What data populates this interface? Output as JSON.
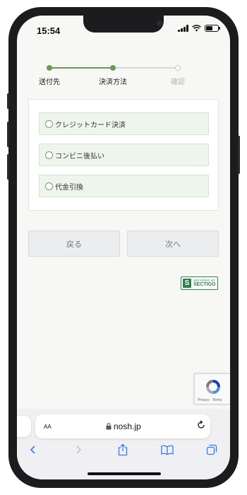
{
  "status_bar": {
    "time": "15:54"
  },
  "stepper": {
    "steps": [
      {
        "label": "送付先",
        "state": "done"
      },
      {
        "label": "決済方法",
        "state": "current"
      },
      {
        "label": "確認",
        "state": "pending"
      }
    ],
    "colors": {
      "active": "#6a9a52",
      "inactive": "#d6d6d6",
      "pending_label": "#b5b5b5"
    }
  },
  "payment_options": [
    {
      "label": "クレジットカード決済",
      "selected": false
    },
    {
      "label": "コンビニ後払い",
      "selected": false
    },
    {
      "label": "代金引換",
      "selected": false
    }
  ],
  "buttons": {
    "back": "戻る",
    "next": "次へ"
  },
  "security_seal": {
    "top_text": "SECURED BY",
    "brand": "SECTIGO",
    "mark": "S"
  },
  "recaptcha": {
    "links": "Privacy - Terms"
  },
  "browser": {
    "aa_label": "AA",
    "url": "nosh.jp",
    "icons": [
      "lock-icon",
      "reload-icon",
      "back-arrow-icon",
      "forward-arrow-icon",
      "share-icon",
      "bookmarks-icon",
      "tabs-icon"
    ]
  }
}
